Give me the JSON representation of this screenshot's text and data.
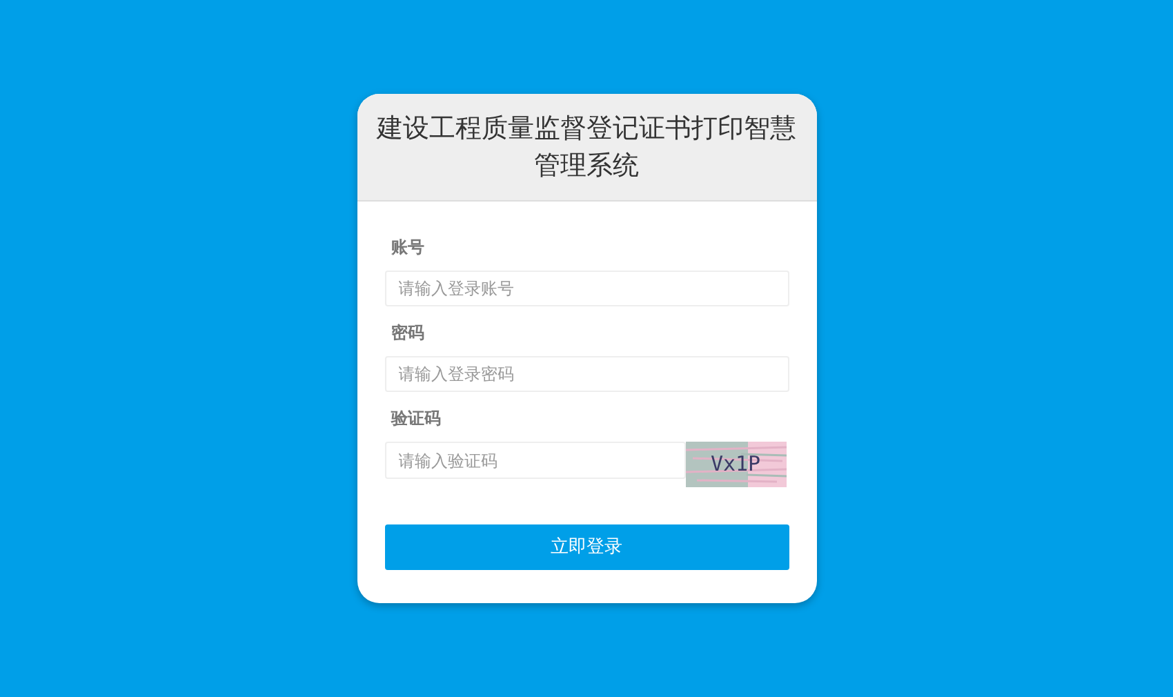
{
  "title": "建设工程质量监督登记证书打印智慧管理系统",
  "fields": [
    {
      "label": "账号",
      "placeholder": "请输入登录账号",
      "kind": "text"
    },
    {
      "label": "密码",
      "placeholder": "请输入登录密码",
      "kind": "password"
    },
    {
      "label": "验证码",
      "placeholder": "请输入验证码",
      "kind": "captcha",
      "captcha": "Vx1P"
    }
  ],
  "submit": "立即登录"
}
